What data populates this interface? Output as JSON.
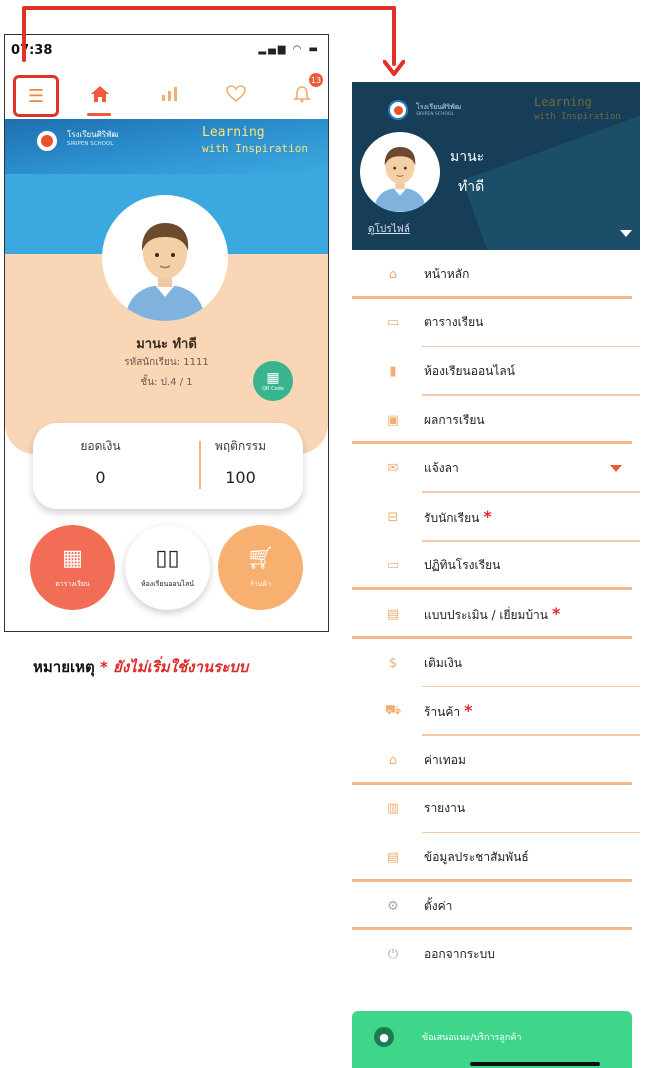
{
  "phone": {
    "status_time": "07:38",
    "nav": {
      "menu_icon": "hamburger-icon",
      "home_icon": "home-icon",
      "chart_icon": "bar-chart-icon",
      "favorite_icon": "heart-icon",
      "notification_icon": "bell-icon",
      "notification_count": "13"
    },
    "banner": {
      "school_name": "โรงเรียนศิริพัฒ",
      "school_name_en": "SIRIPEN SCHOOL",
      "tagline_line1": "Learning",
      "tagline_line2": "with Inspiration"
    },
    "profile": {
      "name": "มานะ ทำดี",
      "student_id": "รหัสนักเรียน: 1111",
      "class": "ชั้น: ป.4 / 1",
      "qr_label": "QR Code"
    },
    "stats": {
      "balance_label": "ยอดเงิน",
      "balance_value": "0",
      "behavior_label": "พฤติกรรม",
      "behavior_value": "100"
    },
    "shortcuts": [
      {
        "label": "ตารางเรียน",
        "icon": "calendar-icon"
      },
      {
        "label": "ห้องเรียนออนไลน์",
        "icon": "book-icon"
      },
      {
        "label": "ร้านค้า",
        "icon": "cart-icon"
      }
    ]
  },
  "note": {
    "prefix": "หมายเหตุ",
    "warning": "* ยังไม่เริ่มใช้งานระบบ"
  },
  "drawer": {
    "school_name": "โรงเรียนศิริพัฒ",
    "school_name_en": "SIRIPEN SCHOOL",
    "tagline_line1": "Learning",
    "tagline_line2": "with Inspiration",
    "first_name": "มานะ",
    "last_name": "ทำดี",
    "profile_link": "ดูโปรไฟล์",
    "menu": [
      {
        "label": "หน้าหลัก",
        "icon": "home-icon",
        "star": ""
      },
      {
        "label": "ตารางเรียน",
        "icon": "calendar-icon",
        "star": ""
      },
      {
        "label": "ห้องเรียนออนไลน์",
        "icon": "book-icon",
        "star": ""
      },
      {
        "label": "ผลการเรียน",
        "icon": "clipboard-icon",
        "star": ""
      },
      {
        "label": "แจ้งลา",
        "icon": "envelope-icon",
        "star": ""
      },
      {
        "label": "รับนักเรียน",
        "icon": "bus-icon",
        "star": "*"
      },
      {
        "label": "ปฏิทินโรงเรียน",
        "icon": "calendar-alt-icon",
        "star": ""
      },
      {
        "label": "แบบประเมิน / เยี่ยมบ้าน",
        "icon": "form-icon",
        "star": "*"
      },
      {
        "label": "เติมเงิน",
        "icon": "dollar-icon",
        "star": ""
      },
      {
        "label": "ร้านค้า",
        "icon": "cart-icon",
        "star": "*"
      },
      {
        "label": "ค่าเทอม",
        "icon": "graduation-cap-icon",
        "star": ""
      },
      {
        "label": "รายงาน",
        "icon": "report-icon",
        "star": ""
      },
      {
        "label": "ข้อมูลประชาสัมพันธ์",
        "icon": "news-icon",
        "star": ""
      },
      {
        "label": "ตั้งค่า",
        "icon": "gear-icon",
        "star": ""
      },
      {
        "label": "ออกจากระบบ",
        "icon": "power-icon",
        "star": ""
      }
    ],
    "feedback_label": "ข้อเสนอแนะ/บริการลูกค้า",
    "feedback_icon": "support-agent-icon"
  },
  "colors": {
    "accent": "#f2833d",
    "highlight": "#e03227",
    "drawer_header": "#173e58",
    "peach": "#f9d6b6",
    "sky": "#3ba9df",
    "feedback_green": "#3fd68c"
  }
}
